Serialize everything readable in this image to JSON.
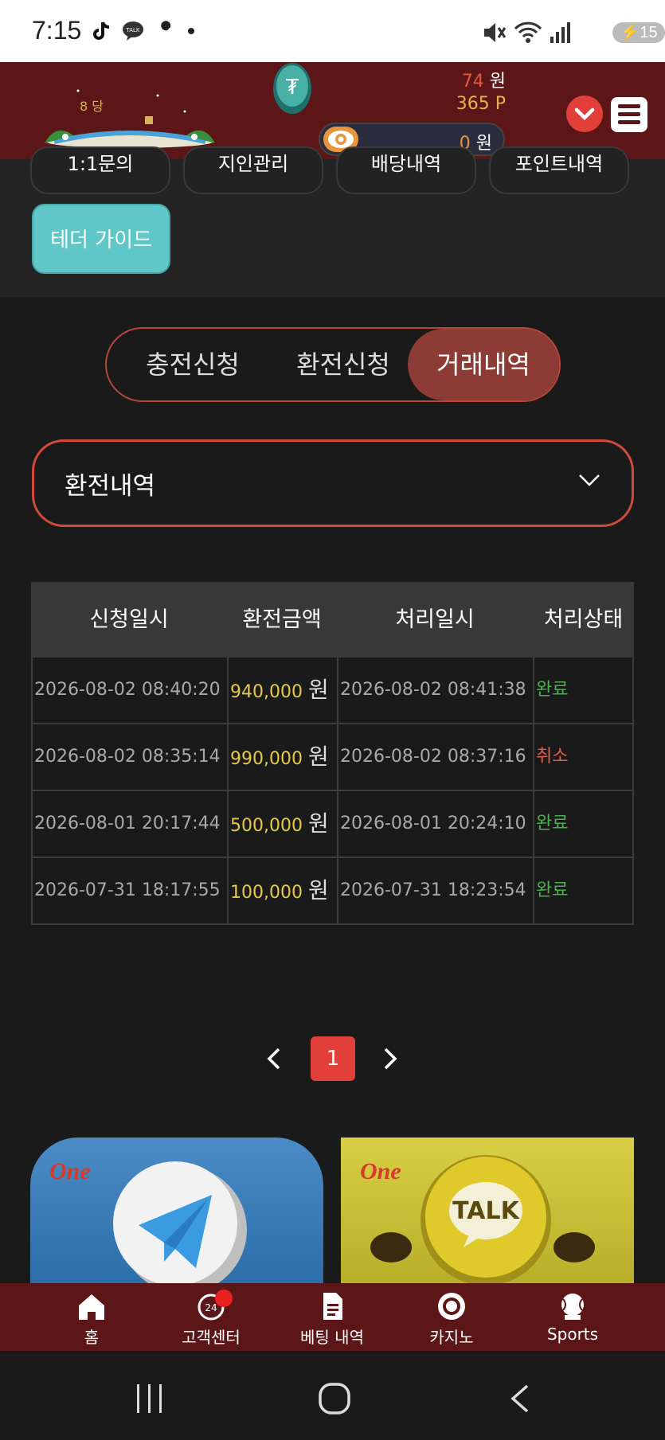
{
  "status_bar": {
    "time": "7:15",
    "battery": "15",
    "left_icons": [
      "tiktok-icon",
      "talk-icon",
      "wrench-icon",
      "dot-icon"
    ],
    "right_icons": [
      "mute-icon",
      "wifi-icon",
      "signal-icon",
      "battery-icon"
    ]
  },
  "header": {
    "logo_text": "8 당",
    "won_value": "74",
    "won_unit": " 원",
    "point_value": "365 P",
    "hidden_value": "0",
    "hidden_unit": " 원"
  },
  "top_buttons": {
    "partial": [
      "1:1문의",
      "지인관리",
      "배당내역",
      "포인트내역"
    ],
    "tether_guide": "테더 가이드"
  },
  "tabs": [
    {
      "label": "충전신청",
      "active": false
    },
    {
      "label": "환전신청",
      "active": false
    },
    {
      "label": "거래내역",
      "active": true
    }
  ],
  "select": {
    "value": "환전내역"
  },
  "table": {
    "headers": [
      "신청일시",
      "환전금액",
      "처리일시",
      "처리상태"
    ],
    "rows": [
      {
        "request": "2026-08-02 08:40:20",
        "amount": "940,000",
        "unit": "원",
        "processed": "2026-08-02 08:41:38",
        "status": "완료",
        "status_type": "done"
      },
      {
        "request": "2026-08-02 08:35:14",
        "amount": "990,000",
        "unit": "원",
        "processed": "2026-08-02 08:37:16",
        "status": "취소",
        "status_type": "cancel"
      },
      {
        "request": "2026-08-01 20:17:44",
        "amount": "500,000",
        "unit": "원",
        "processed": "2026-08-01 20:24:10",
        "status": "완료",
        "status_type": "done"
      },
      {
        "request": "2026-07-31 18:17:55",
        "amount": "100,000",
        "unit": "원",
        "processed": "2026-07-31 18:23:54",
        "status": "완료",
        "status_type": "done"
      }
    ]
  },
  "pagination": {
    "current": "1"
  },
  "banners": {
    "brand": "One",
    "talk_text": "TALK"
  },
  "bottom_nav": [
    {
      "label": "홈",
      "icon": "home-icon"
    },
    {
      "label": "고객센터",
      "icon": "support-24-icon"
    },
    {
      "label": "베팅 내역",
      "icon": "document-icon"
    },
    {
      "label": "카지노",
      "icon": "casino-chip-icon"
    },
    {
      "label": "Sports",
      "icon": "baseball-icon"
    }
  ],
  "colors": {
    "header_bg": "#5c1617",
    "accent_red": "#e23e3a",
    "tab_active": "#8c3b35",
    "tether": "#5fc7c8",
    "status_done": "#4caf50",
    "status_cancel": "#e45a4a",
    "amount": "#e6c94a"
  }
}
